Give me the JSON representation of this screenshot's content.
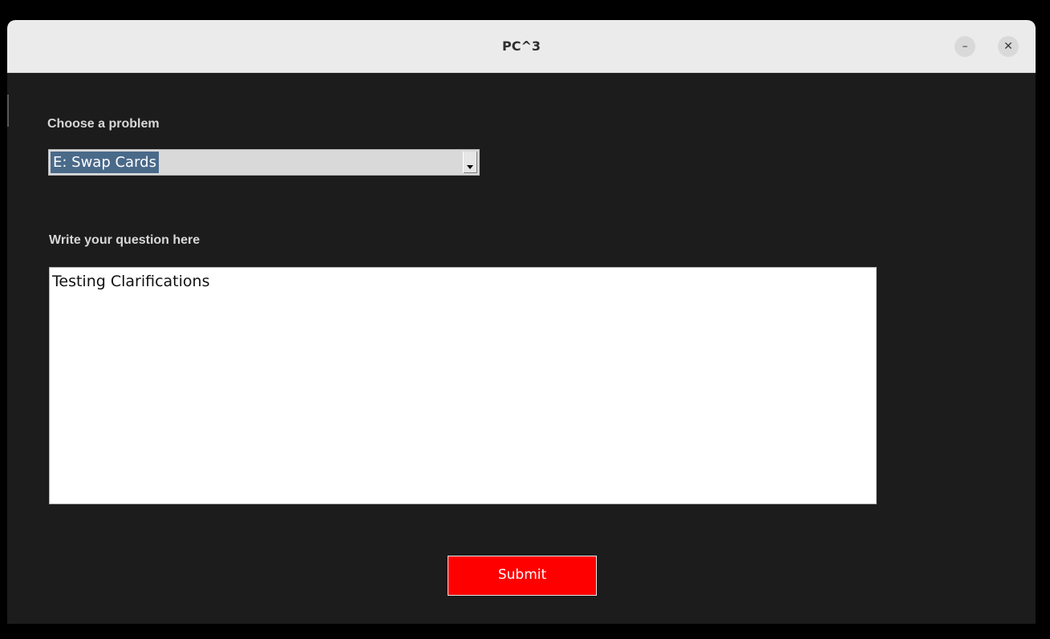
{
  "window": {
    "title": "PC^3",
    "minimize_glyph": "–",
    "close_glyph": "✕"
  },
  "form": {
    "problem_label": "Choose a problem",
    "problem_selected": "E: Swap Cards",
    "question_label": "Write your question here",
    "question_value": "Testing Clarifications",
    "submit_label": "Submit"
  },
  "colors": {
    "background": "#1c1c1c",
    "submit": "#ff0000",
    "selection": "#4a6a8a"
  },
  "icons": {
    "minimize": "minimize-icon",
    "close": "close-icon",
    "dropdown": "chevron-down-icon"
  }
}
